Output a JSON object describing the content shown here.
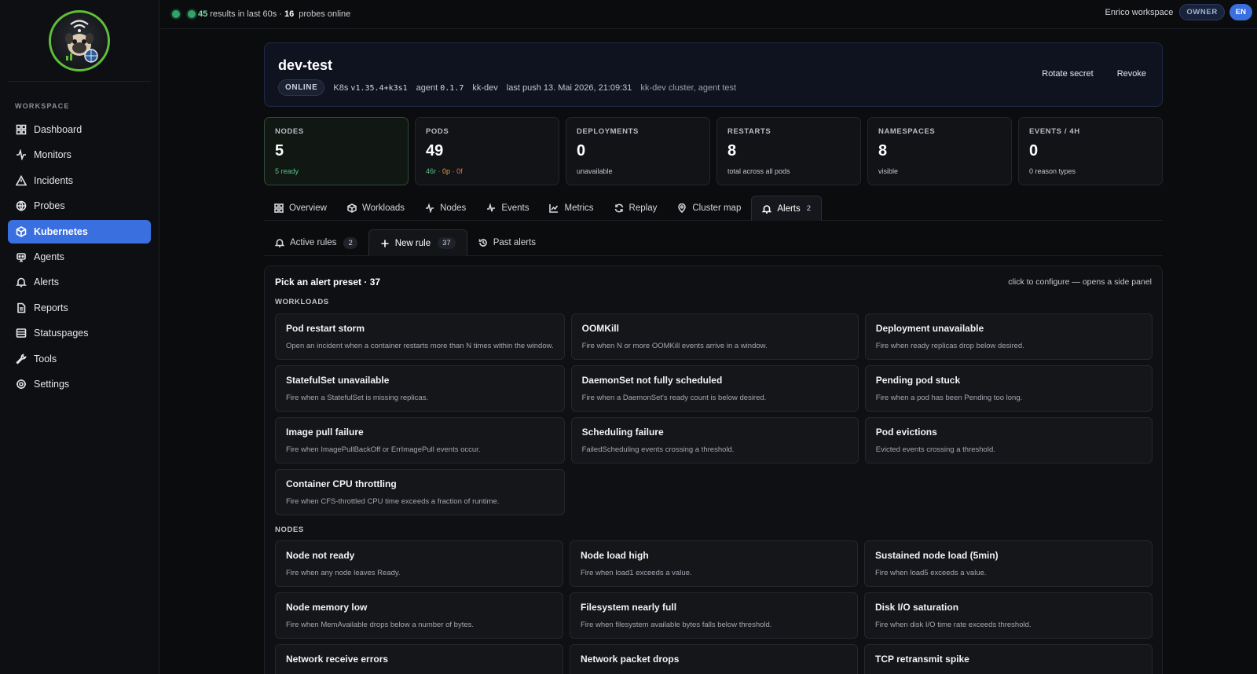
{
  "topbar": {
    "results_count": "45",
    "results_text": "results in last 60s ·",
    "probes_count": "16",
    "probes_text": "probes online",
    "workspace": "Enrico workspace",
    "role": "OWNER",
    "lang": "EN"
  },
  "sidebar": {
    "section": "WORKSPACE",
    "items": [
      {
        "label": "Dashboard",
        "icon": "dashboard-icon"
      },
      {
        "label": "Monitors",
        "icon": "activity-icon"
      },
      {
        "label": "Incidents",
        "icon": "warning-icon"
      },
      {
        "label": "Probes",
        "icon": "globe-icon"
      },
      {
        "label": "Kubernetes",
        "icon": "cube-icon",
        "active": true
      },
      {
        "label": "Agents",
        "icon": "robot-icon"
      },
      {
        "label": "Alerts",
        "icon": "bell-icon"
      },
      {
        "label": "Reports",
        "icon": "document-icon"
      },
      {
        "label": "Statuspages",
        "icon": "layout-icon"
      },
      {
        "label": "Tools",
        "icon": "wrench-icon"
      },
      {
        "label": "Settings",
        "icon": "gear-icon"
      }
    ]
  },
  "cluster": {
    "name": "dev-test",
    "status": "ONLINE",
    "k8s_label": "K8s",
    "k8s_version": "v1.35.4+k3s1",
    "agent_label": "agent",
    "agent_version": "0.1.7",
    "context": "kk-dev",
    "last_push": "last push 13. Mai 2026, 21:09:31",
    "description": "kk-dev cluster, agent test",
    "rotate_label": "Rotate secret",
    "revoke_label": "Revoke"
  },
  "stats": {
    "nodes": {
      "label": "NODES",
      "value": "5",
      "sub": "5 ready"
    },
    "pods": {
      "label": "PODS",
      "value": "49",
      "sub_r": "46r",
      "sub_p": "0p",
      "sub_f": "0f",
      "sep": "·"
    },
    "deployments": {
      "label": "DEPLOYMENTS",
      "value": "0",
      "sub": "unavailable"
    },
    "restarts": {
      "label": "RESTARTS",
      "value": "8",
      "sub": "total across all pods"
    },
    "namespaces": {
      "label": "NAMESPACES",
      "value": "8",
      "sub": "visible"
    },
    "events": {
      "label": "EVENTS / 4H",
      "value": "0",
      "sub": "0 reason types"
    }
  },
  "tabs": [
    {
      "label": "Overview"
    },
    {
      "label": "Workloads"
    },
    {
      "label": "Nodes"
    },
    {
      "label": "Events"
    },
    {
      "label": "Metrics"
    },
    {
      "label": "Replay"
    },
    {
      "label": "Cluster map"
    },
    {
      "label": "Alerts",
      "count": "2",
      "active": true
    }
  ],
  "subtabs": [
    {
      "label": "Active rules",
      "count": "2"
    },
    {
      "label": "New rule",
      "count": "37",
      "active": true
    },
    {
      "label": "Past alerts"
    }
  ],
  "presets": {
    "title": "Pick an alert preset · 37",
    "hint": "click to configure — opens a side panel",
    "workloads_label": "WORKLOADS",
    "nodes_label": "NODES",
    "workloads": [
      {
        "title": "Pod restart storm",
        "desc": "Open an incident when a container restarts more than N times within the window."
      },
      {
        "title": "OOMKill",
        "desc": "Fire when N or more OOMKill events arrive in a window."
      },
      {
        "title": "Deployment unavailable",
        "desc": "Fire when ready replicas drop below desired."
      },
      {
        "title": "StatefulSet unavailable",
        "desc": "Fire when a StatefulSet is missing replicas."
      },
      {
        "title": "DaemonSet not fully scheduled",
        "desc": "Fire when a DaemonSet's ready count is below desired."
      },
      {
        "title": "Pending pod stuck",
        "desc": "Fire when a pod has been Pending too long."
      },
      {
        "title": "Image pull failure",
        "desc": "Fire when ImagePullBackOff or ErrImagePull events occur."
      },
      {
        "title": "Scheduling failure",
        "desc": "FailedScheduling events crossing a threshold."
      },
      {
        "title": "Pod evictions",
        "desc": "Evicted events crossing a threshold."
      },
      {
        "title": "Container CPU throttling",
        "desc": "Fire when CFS-throttled CPU time exceeds a fraction of runtime."
      }
    ],
    "nodes": [
      {
        "title": "Node not ready",
        "desc": "Fire when any node leaves Ready."
      },
      {
        "title": "Node load high",
        "desc": "Fire when load1 exceeds a value."
      },
      {
        "title": "Sustained node load (5min)",
        "desc": "Fire when load5 exceeds a value."
      },
      {
        "title": "Node memory low",
        "desc": "Fire when MemAvailable drops below a number of bytes."
      },
      {
        "title": "Filesystem nearly full",
        "desc": "Fire when filesystem available bytes falls below threshold."
      },
      {
        "title": "Disk I/O saturation",
        "desc": "Fire when disk I/O time rate exceeds threshold."
      },
      {
        "title": "Network receive errors",
        "desc": ""
      },
      {
        "title": "Network packet drops",
        "desc": ""
      },
      {
        "title": "TCP retransmit spike",
        "desc": ""
      }
    ]
  }
}
